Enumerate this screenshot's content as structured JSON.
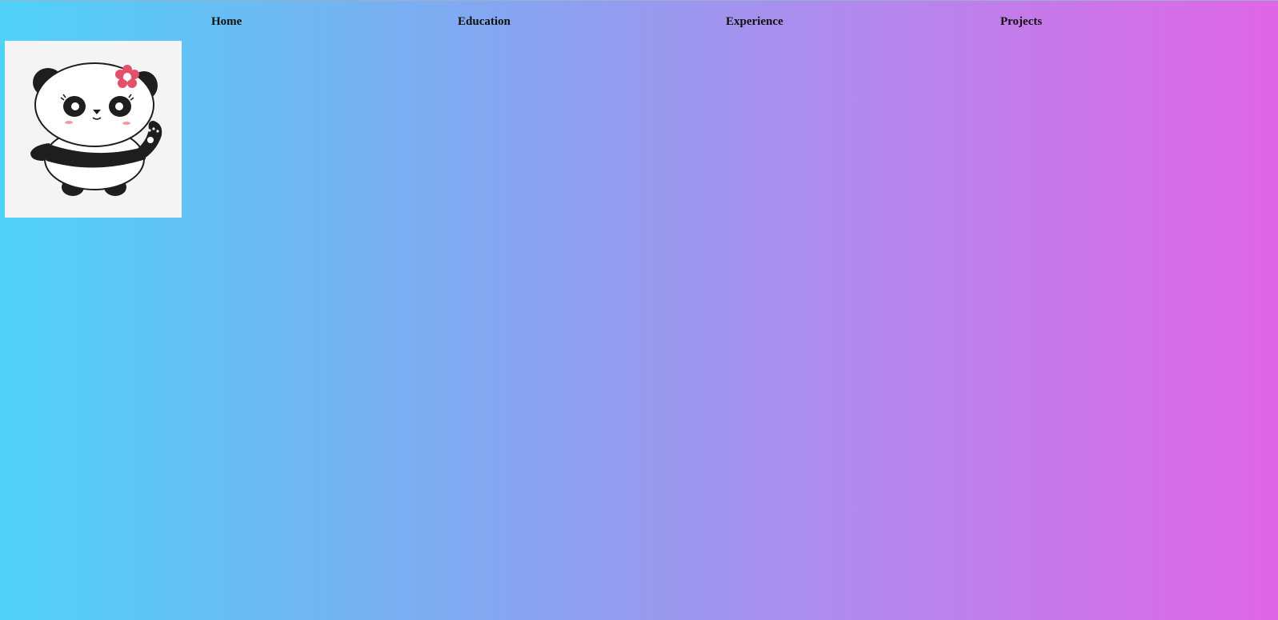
{
  "nav": {
    "items": [
      {
        "label": "Home"
      },
      {
        "label": "Education"
      },
      {
        "label": "Experience"
      },
      {
        "label": "Projects"
      }
    ]
  },
  "avatar": {
    "icon": "panda-mascot-icon"
  },
  "colors": {
    "gradient_left": "#4fd2f8",
    "gradient_right": "#e066e6",
    "nav_text": "#111111"
  }
}
